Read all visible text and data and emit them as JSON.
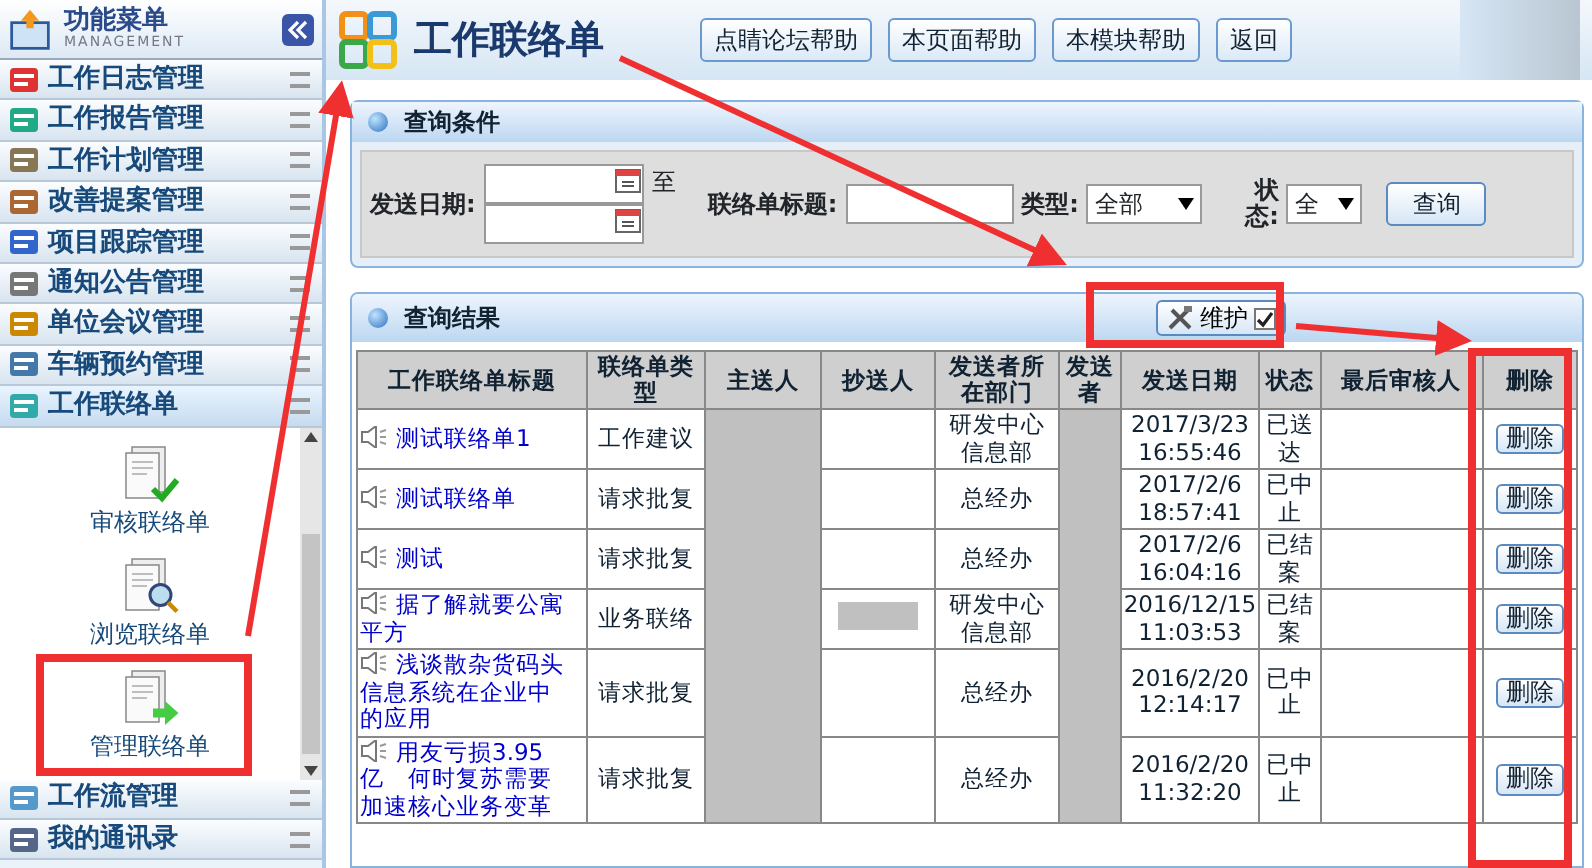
{
  "sidebar": {
    "title": "功能菜单",
    "subtitle": "MANAGEMENT",
    "items": [
      {
        "label": "工作日志管理",
        "expanded": false
      },
      {
        "label": "工作报告管理",
        "expanded": false
      },
      {
        "label": "工作计划管理",
        "expanded": false
      },
      {
        "label": "改善提案管理",
        "expanded": false
      },
      {
        "label": "项目跟踪管理",
        "expanded": false
      },
      {
        "label": "通知公告管理",
        "expanded": false
      },
      {
        "label": "单位会议管理",
        "expanded": false
      },
      {
        "label": "车辆预约管理",
        "expanded": false
      },
      {
        "label": "工作联络单",
        "expanded": true,
        "children": [
          {
            "label": "审核联络单",
            "kind": "approve"
          },
          {
            "label": "浏览联络单",
            "kind": "browse"
          },
          {
            "label": "管理联络单",
            "kind": "manage"
          }
        ]
      },
      {
        "label": "工作流管理",
        "expanded": false
      },
      {
        "label": "我的通讯录",
        "expanded": false
      }
    ]
  },
  "header": {
    "title": "工作联络单",
    "buttons": [
      "点睛论坛帮助",
      "本页面帮助",
      "本模块帮助",
      "返回"
    ]
  },
  "query": {
    "title": "查询条件",
    "date_label": "发送日期:",
    "date_to": "至",
    "subject_label": "联络单标题:",
    "type_label": "类型:",
    "type_value": "全部",
    "status_label": "状态:",
    "status_value": "全",
    "search_button": "查询"
  },
  "results": {
    "title": "查询结果",
    "maintain_button": "维护",
    "maintain_checked": true,
    "columns": [
      "工作联络单标题",
      "联络单类型",
      "主送人",
      "抄送人",
      "发送者所在部门",
      "发送者",
      "发送日期",
      "状态",
      "最后审核人",
      "删除"
    ],
    "rows": [
      {
        "title": "测试联络单1",
        "type": "工作建议",
        "cc_redacted": false,
        "department": "研发中心信息部",
        "date": "2017/3/23\n16:55:46",
        "status": "已送达",
        "delete": "删除"
      },
      {
        "title": "测试联络单",
        "type": "请求批复",
        "cc_redacted": false,
        "department": "总经办",
        "date": "2017/2/6\n18:57:41",
        "status": "已中止",
        "delete": "删除"
      },
      {
        "title": "测试",
        "type": "请求批复",
        "cc_redacted": false,
        "department": "总经办",
        "date": "2017/2/6\n16:04:16",
        "status": "已结案",
        "delete": "删除"
      },
      {
        "title": "据了解就要公寓平方",
        "type": "业务联络",
        "cc_redacted": true,
        "department": "研发中心信息部",
        "date": "2016/12/15\n11:03:53",
        "status": "已结案",
        "delete": "删除"
      },
      {
        "title": "浅谈散杂货码头信息系统在企业中的应用",
        "type": "请求批复",
        "cc_redacted": false,
        "department": "总经办",
        "date": "2016/2/20\n12:14:17",
        "status": "已中止",
        "delete": "删除"
      },
      {
        "title": "用友亏损3.95亿　何时复苏需要加速核心业务变革",
        "type": "请求批复",
        "cc_redacted": false,
        "department": "总经办",
        "date": "2016/2/20\n11:32:20",
        "status": "已中止",
        "delete": "删除"
      }
    ]
  }
}
